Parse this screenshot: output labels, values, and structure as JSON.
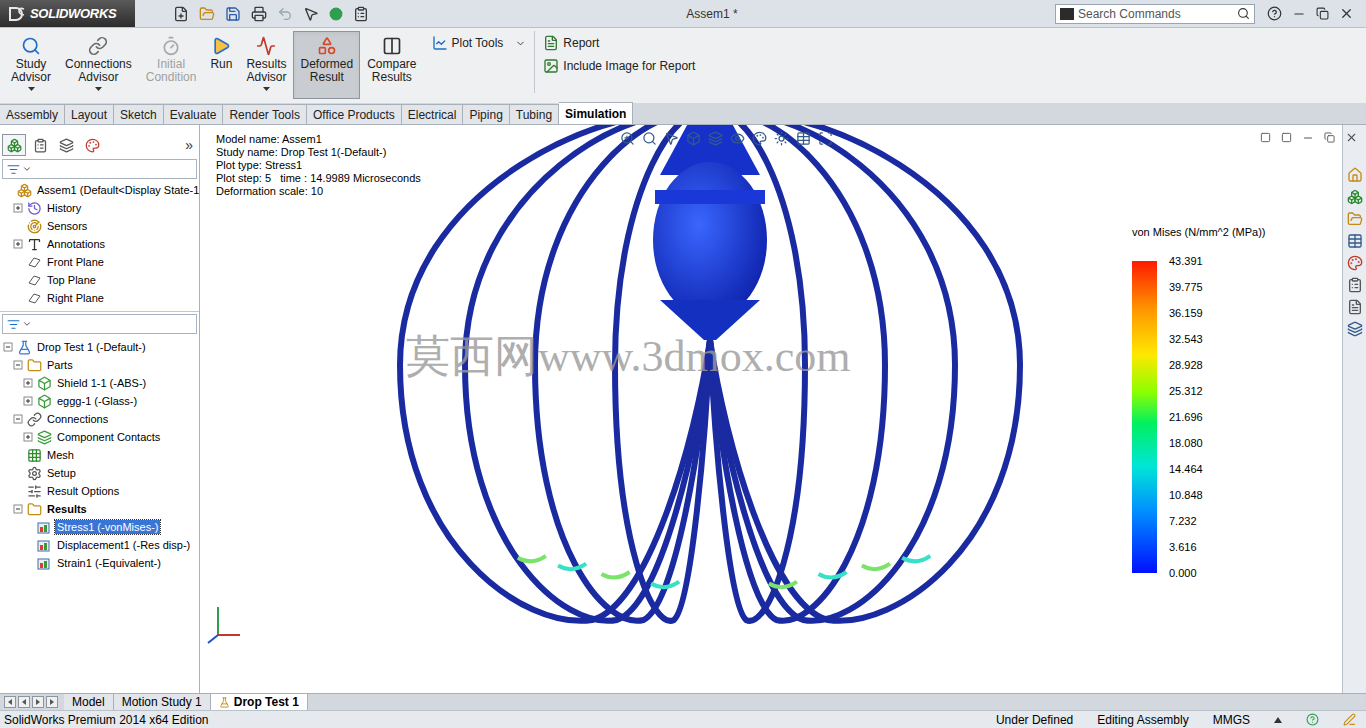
{
  "window": {
    "app": "SOLIDWORKS",
    "title": "Assem1 *"
  },
  "search": {
    "placeholder": "Search Commands"
  },
  "ribbon": [
    {
      "label": "Study Advisor",
      "kind": "study",
      "selected": false,
      "disabled": false,
      "dropdown": true
    },
    {
      "label": "Connections Advisor",
      "kind": "connections",
      "selected": false,
      "disabled": false,
      "dropdown": true
    },
    {
      "label": "Initial Condition",
      "kind": "initial",
      "selected": false,
      "disabled": true,
      "dropdown": false
    },
    {
      "label": "Run",
      "kind": "run",
      "selected": false,
      "disabled": false,
      "dropdown": false
    },
    {
      "label": "Results Advisor",
      "kind": "results",
      "selected": false,
      "disabled": false,
      "dropdown": true
    },
    {
      "label": "Deformed Result",
      "kind": "deformed",
      "selected": true,
      "disabled": false,
      "dropdown": false
    },
    {
      "label": "Compare Results",
      "kind": "compare",
      "selected": false,
      "disabled": false,
      "dropdown": false
    }
  ],
  "ribbon_small": [
    {
      "label": "Plot Tools",
      "kind": "plot",
      "dropdown": true
    },
    {
      "label": "Report",
      "kind": "report",
      "dropdown": false
    },
    {
      "label": "Include Image for Report",
      "kind": "image",
      "dropdown": false
    }
  ],
  "tabs": [
    {
      "label": "Assembly",
      "selected": false
    },
    {
      "label": "Layout",
      "selected": false
    },
    {
      "label": "Sketch",
      "selected": false
    },
    {
      "label": "Evaluate",
      "selected": false
    },
    {
      "label": "Render Tools",
      "selected": false
    },
    {
      "label": "Office Products",
      "selected": false
    },
    {
      "label": "Electrical",
      "selected": false
    },
    {
      "label": "Piping",
      "selected": false
    },
    {
      "label": "Tubing",
      "selected": false
    },
    {
      "label": "Simulation",
      "selected": true
    }
  ],
  "panel_more": "»",
  "feature_tree": [
    {
      "label": "Assem1  (Default<Display State-1",
      "depth": 0,
      "expander": "none",
      "kind": "assembly",
      "bold": false,
      "selected": false
    },
    {
      "label": "History",
      "depth": 1,
      "expander": "collapsed",
      "kind": "history",
      "bold": false,
      "selected": false
    },
    {
      "label": "Sensors",
      "depth": 1,
      "expander": "none",
      "kind": "sensors",
      "bold": false,
      "selected": false
    },
    {
      "label": "Annotations",
      "depth": 1,
      "expander": "collapsed",
      "kind": "annotations",
      "bold": false,
      "selected": false
    },
    {
      "label": "Front Plane",
      "depth": 1,
      "expander": "none",
      "kind": "plane",
      "bold": false,
      "selected": false
    },
    {
      "label": "Top Plane",
      "depth": 1,
      "expander": "none",
      "kind": "plane",
      "bold": false,
      "selected": false
    },
    {
      "label": "Right Plane",
      "depth": 1,
      "expander": "none",
      "kind": "plane",
      "bold": false,
      "selected": false
    }
  ],
  "study_tree": [
    {
      "label": "Drop Test 1 (-Default-)",
      "depth": 0,
      "expander": "expanded",
      "kind": "study",
      "bold": false,
      "selected": false
    },
    {
      "label": "Parts",
      "depth": 1,
      "expander": "expanded",
      "kind": "parts",
      "bold": false,
      "selected": false
    },
    {
      "label": "Shield 1-1 (-ABS-)",
      "depth": 2,
      "expander": "collapsed",
      "kind": "part",
      "bold": false,
      "selected": false
    },
    {
      "label": "eggg-1 (-Glass-)",
      "depth": 2,
      "expander": "collapsed",
      "kind": "part",
      "bold": false,
      "selected": false
    },
    {
      "label": "Connections",
      "depth": 1,
      "expander": "expanded",
      "kind": "connections",
      "bold": false,
      "selected": false
    },
    {
      "label": "Component Contacts",
      "depth": 2,
      "expander": "collapsed",
      "kind": "contacts",
      "bold": false,
      "selected": false
    },
    {
      "label": "Mesh",
      "depth": 1,
      "expander": "none",
      "kind": "mesh",
      "bold": false,
      "selected": false
    },
    {
      "label": "Setup",
      "depth": 1,
      "expander": "none",
      "kind": "setup",
      "bold": false,
      "selected": false
    },
    {
      "label": "Result Options",
      "depth": 1,
      "expander": "none",
      "kind": "options",
      "bold": false,
      "selected": false
    },
    {
      "label": "Results",
      "depth": 1,
      "expander": "expanded",
      "kind": "folder",
      "bold": true,
      "selected": false
    },
    {
      "label": "Stress1 (-vonMises-)",
      "depth": 2,
      "expander": "none",
      "kind": "stress",
      "bold": false,
      "selected": true
    },
    {
      "label": "Displacement1 (-Res disp-)",
      "depth": 2,
      "expander": "none",
      "kind": "displacement",
      "bold": false,
      "selected": false
    },
    {
      "label": "Strain1 (-Equivalent-)",
      "depth": 2,
      "expander": "none",
      "kind": "strain",
      "bold": false,
      "selected": false
    }
  ],
  "viewport": {
    "info": [
      "Model name: Assem1",
      "Study name: Drop Test 1(-Default-)",
      "Plot type: Stress1",
      "Plot step: 5   time : 14.9989 Microseconds",
      "Deformation scale: 10"
    ],
    "watermark": "莫西网www.3dmox.com"
  },
  "legend": {
    "title": "von Mises (N/mm^2 (MPa))",
    "ticks": [
      "43.391",
      "39.775",
      "36.159",
      "32.543",
      "28.928",
      "25.312",
      "21.696",
      "18.080",
      "14.464",
      "10.848",
      "7.232",
      "3.616",
      "0.000"
    ]
  },
  "bottom_tabs": [
    {
      "label": "Model",
      "selected": false
    },
    {
      "label": "Motion Study 1",
      "selected": false
    },
    {
      "label": "Drop Test 1",
      "selected": true
    }
  ],
  "status_bar": {
    "edition": "SolidWorks Premium 2014 x64 Edition",
    "items": [
      "Under Defined",
      "Editing Assembly",
      "MMGS"
    ]
  }
}
